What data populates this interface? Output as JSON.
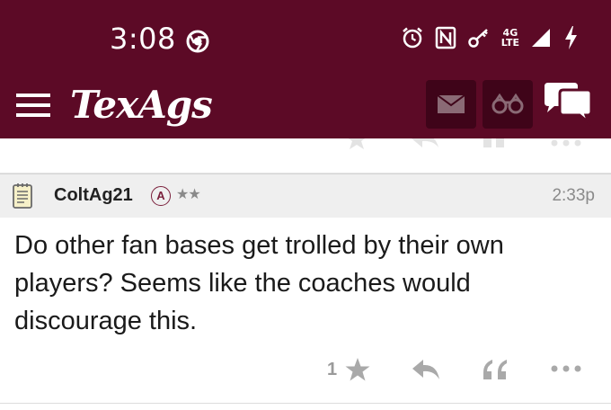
{
  "status_bar": {
    "time": "3:08",
    "network_label_top": "4G",
    "network_label_bottom": "LTE",
    "icons": [
      "chrome-icon",
      "alarm-icon",
      "nfc-icon",
      "key-icon",
      "signal-icon",
      "battery-charging-icon"
    ]
  },
  "app_bar": {
    "brand": "TexAgs",
    "icons": [
      "menu-icon",
      "mail-icon",
      "binoculars-icon",
      "chat-icon"
    ]
  },
  "post": {
    "username": "ColtAg21",
    "badge": "A",
    "stars": "★★",
    "time": "2:33p",
    "body": "Do other fan bases get trolled by their own players? Seems like the coaches would discourage this.",
    "star_count": "1"
  },
  "colors": {
    "maroon": "#5c0a26",
    "maroon_dark": "#3f0419",
    "header_bg": "#efefef",
    "muted": "#9a9a9a"
  }
}
